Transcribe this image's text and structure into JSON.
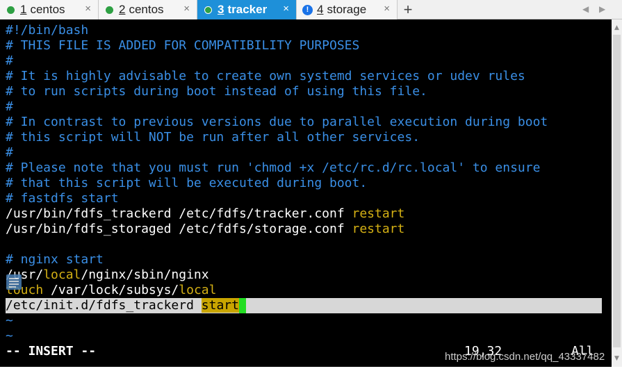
{
  "tabs": [
    {
      "num": "1",
      "label": "centos",
      "status_color": "#2ea043"
    },
    {
      "num": "2",
      "label": "centos",
      "status_color": "#2ea043"
    },
    {
      "num": "3",
      "label": "tracker",
      "status_color": "#2ea043"
    },
    {
      "num": "4",
      "label": "storage",
      "status_color": "#1a73e8"
    }
  ],
  "tab_close": "×",
  "new_tab": "+",
  "nav_prev": "◀",
  "nav_next": "▶",
  "warn_glyph": "!",
  "colors": {
    "comment": "#3a8fe6",
    "keyword": "#d4b014",
    "active_tab": "#1e90d9",
    "cursor": "#22dd22"
  },
  "terminal": {
    "lines": [
      "#!/bin/bash",
      "# THIS FILE IS ADDED FOR COMPATIBILITY PURPOSES",
      "#",
      "# It is highly advisable to create own systemd services or udev rules",
      "# to run scripts during boot instead of using this file.",
      "#",
      "# In contrast to previous versions due to parallel execution during boot",
      "# this script will NOT be run after all other services.",
      "#",
      "# Please note that you must run 'chmod +x /etc/rc.d/rc.local' to ensure",
      "# that this script will be executed during boot.",
      "# fastdfs start"
    ],
    "tracker_cmd": "/usr/bin/fdfs_trackerd /etc/fdfs/tracker.conf ",
    "storage_cmd": "/usr/bin/fdfs_storaged /etc/fdfs/storage.conf ",
    "restart": "restart",
    "nginx_comment": "# nginx start",
    "nginx_pre": "/usr/",
    "local": "local",
    "nginx_post": "/nginx/sbin/nginx",
    "touch": "touch",
    "touch_path": " /var/lock/subsys/",
    "current_cmd": "/etc/init.d/fdfs_trackerd ",
    "start": "start",
    "tilde": "~",
    "mode": "-- INSERT --",
    "position": "19,32",
    "scroll_pos": "All"
  },
  "watermark": "https://blog.csdn.net/qq_43337482"
}
